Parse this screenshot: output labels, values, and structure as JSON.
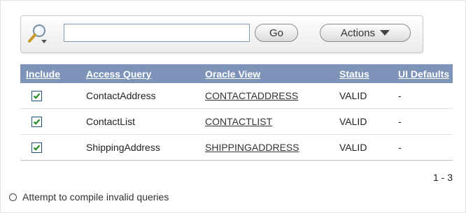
{
  "toolbar": {
    "search_icon": "search-magnifier-icon",
    "search_value": "",
    "go_label": "Go",
    "actions_label": "Actions"
  },
  "table": {
    "headers": [
      "Include",
      "Access Query",
      "Oracle View",
      "Status",
      "UI Defaults"
    ],
    "rows": [
      {
        "include": true,
        "query": "ContactAddress",
        "view": "CONTACTADDRESS",
        "status": "VALID",
        "ui_defaults": "-"
      },
      {
        "include": true,
        "query": "ContactList",
        "view": "CONTACTLIST",
        "status": "VALID",
        "ui_defaults": "-"
      },
      {
        "include": true,
        "query": "ShippingAddress",
        "view": "SHIPPINGADDRESS",
        "status": "VALID",
        "ui_defaults": "-"
      }
    ]
  },
  "pagination": "1 - 3",
  "compile_option": {
    "label": "Attempt to compile invalid queries",
    "selected": false
  },
  "colors": {
    "header_bg": "#7d93b7",
    "header_text": "#ffffff",
    "checkbox_check": "#1f8a1f"
  }
}
